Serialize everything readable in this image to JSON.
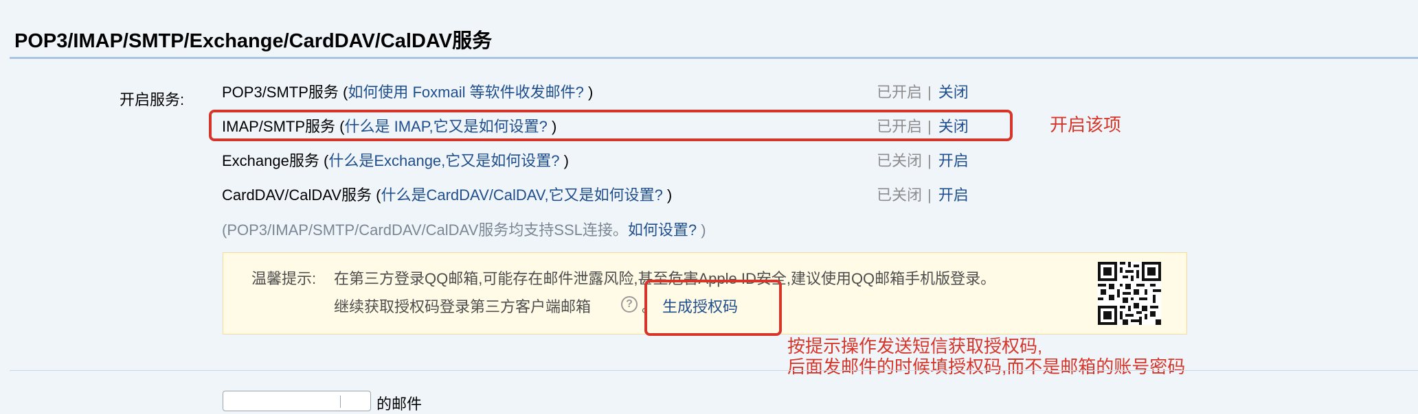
{
  "section_title": "POP3/IMAP/SMTP/Exchange/CardDAV/CalDAV服务",
  "field_label": "开启服务:",
  "services": [
    {
      "name": "POP3/SMTP服务",
      "open_paren": " (",
      "help": "如何使用 Foxmail 等软件收发邮件?",
      "close_paren": " )",
      "status": "已开启",
      "action": "关闭"
    },
    {
      "name": "IMAP/SMTP服务",
      "open_paren": " (",
      "help": "什么是 IMAP,它又是如何设置?",
      "close_paren": " )",
      "status": "已开启",
      "action": "关闭"
    },
    {
      "name": "Exchange服务",
      "open_paren": " (",
      "help": "什么是Exchange,它又是如何设置?",
      "close_paren": " )",
      "status": "已关闭",
      "action": "开启"
    },
    {
      "name": "CardDAV/CalDAV服务",
      "open_paren": " (",
      "help": "什么是CardDAV/CalDAV,它又是如何设置?",
      "close_paren": " )",
      "status": "已关闭",
      "action": "开启"
    }
  ],
  "status_separator": "|",
  "ssl_note": {
    "prefix": "(POP3/IMAP/SMTP/CardDAV/CalDAV服务均支持SSL连接。",
    "link": "如何设置?",
    "suffix": " )"
  },
  "tip": {
    "label": "温馨提示:",
    "line1": "在第三方登录QQ邮箱,可能存在邮件泄露风险,甚至危害Apple ID安全,建议使用QQ邮箱手机版登录。",
    "line2": "继续获取授权码登录第三方客户端邮箱",
    "help_icon_glyph": "?",
    "after_icon": "。",
    "generate_link": "生成授权码"
  },
  "annotations": {
    "enable_this": "开启该项",
    "instruction_line1": "按提示操作发送短信获取授权码,",
    "instruction_line2": "后面发邮件的时候填授权码,而不是邮箱的账号密码"
  },
  "partial_bottom_text": "的邮件",
  "colors": {
    "page_bg": "#f0f5fa",
    "link": "#1f4e8c",
    "muted": "#8c8c8c",
    "annotation_red": "#d6362a",
    "tip_bg": "#fffbe6",
    "tip_border": "#f2dc98",
    "title_rule": "#a9c3e4"
  },
  "icons": [
    "help-circle-icon",
    "qr-code-icon"
  ]
}
